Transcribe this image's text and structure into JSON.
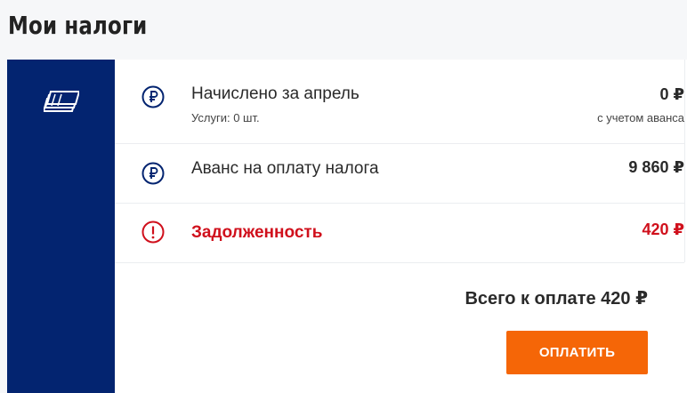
{
  "page": {
    "title": "Мои налоги"
  },
  "colors": {
    "sidebar": "#032470",
    "accent": "#f56607",
    "debt": "#d0101c"
  },
  "icons": {
    "sidebar": "money-stack-icon",
    "ruble": "ruble-icon",
    "warning": "warning-icon"
  },
  "rows": [
    {
      "label": "Начислено за апрель",
      "sublabel": "Услуги: 0 шт.",
      "amount": "0 ₽",
      "amount_note": "с учетом аванса",
      "icon": "ruble-icon"
    },
    {
      "label": "Аванс на оплату налога",
      "amount": "9 860 ₽",
      "icon": "ruble-icon"
    },
    {
      "label": "Задолженность",
      "amount": "420 ₽",
      "icon": "warning-icon"
    }
  ],
  "total": {
    "text": "Всего к оплате 420 ₽"
  },
  "actions": {
    "pay_label": "ОПЛАТИТЬ"
  }
}
